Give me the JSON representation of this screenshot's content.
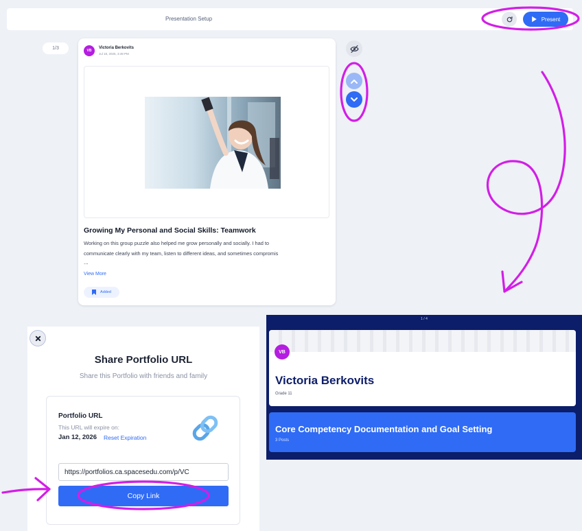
{
  "setup_bar": {
    "title": "Presentation Setup",
    "refresh_icon": "refresh-icon",
    "present_label": "Present"
  },
  "post": {
    "page_indicator": "1/3",
    "author_initials": "VB",
    "author_name": "Victoria Berkovits",
    "author_date": "Jul 18, 2025, 3:49 PM",
    "title": "Growing My Personal and Social Skills: Teamwork",
    "body_line_1": "Working on this group puzzle also helped me grow personally and socially. I had to",
    "body_line_2": "communicate clearly with my team, listen to different ideas, and sometimes compromis",
    "ellipsis": "...",
    "view_more_label": "View More",
    "added_label": "Added"
  },
  "share_dialog": {
    "title": "Share Portfolio URL",
    "subtitle": "Share this Portfolio with friends and family",
    "url_label": "Portfolio URL",
    "expire_text": "This URL will expire on:",
    "expire_date": "Jan 12, 2026",
    "reset_label": "Reset Expiration",
    "url_value": "https://portfolios.ca.spacesedu.com/p/VC",
    "copy_label": "Copy Link"
  },
  "preview": {
    "counter": "1 / 4",
    "initials": "VB",
    "name": "Victoria Berkovits",
    "grade": "Grade 11",
    "collection_title": "Core Competency Documentation and Goal Setting",
    "collection_count": "3 Posts"
  },
  "colors": {
    "accent_blue": "#2f6bf5",
    "navy": "#0c1d69",
    "avatar_purple": "#b41ee0",
    "annotation_magenta": "#d21ee6",
    "canvas": "#eef1f6"
  }
}
